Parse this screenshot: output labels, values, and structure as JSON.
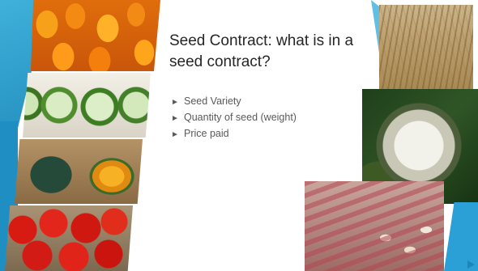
{
  "slide": {
    "title": "Seed Contract: what is in a seed contract?",
    "bullet_glyph": "►",
    "bullets": [
      "Seed Variety",
      "Quantity of seed (weight)",
      "Price paid"
    ],
    "images": {
      "left": [
        "peppers",
        "cucumbers",
        "squash",
        "tomatoes"
      ],
      "right": [
        "seed-field",
        "onion-seed-head",
        "beans"
      ]
    },
    "colors": {
      "accent": "#1d86b8",
      "title_text": "#262626",
      "body_text": "#595959"
    }
  }
}
